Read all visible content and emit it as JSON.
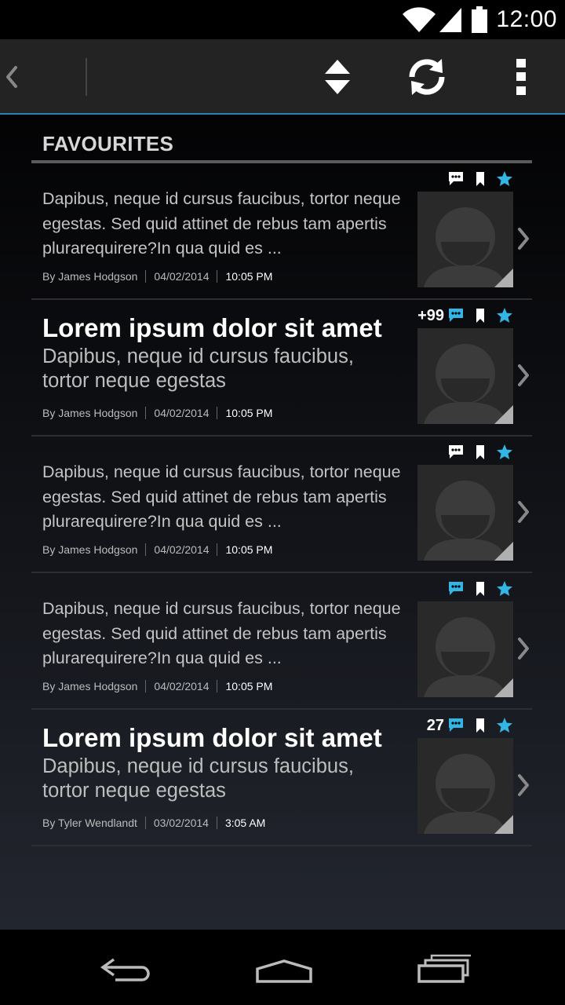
{
  "status_bar": {
    "time": "12:00",
    "icons": [
      "wifi-icon",
      "signal-icon",
      "battery-icon"
    ]
  },
  "action_bar": {
    "icons": [
      "back-icon",
      "sort-icon",
      "refresh-icon",
      "overflow-menu-icon"
    ]
  },
  "section": {
    "title": "FAVOURITES"
  },
  "items": [
    {
      "type": "summary",
      "summary": "Dapibus, neque id cursus faucibus, tortor neque egestas. Sed quid attinet de rebus tam apertis plurarequirere?In qua quid es ...",
      "author": "By James Hodgson",
      "date": "04/02/2014",
      "time": "10:05 PM",
      "comment_count": "",
      "comment_active": false
    },
    {
      "type": "headline",
      "headline": "Lorem ipsum dolor sit amet",
      "subhead": "Dapibus, neque id cursus faucibus, tortor neque egestas",
      "author": "By James Hodgson",
      "date": "04/02/2014",
      "time": "10:05 PM",
      "comment_count": "+99",
      "comment_active": true
    },
    {
      "type": "summary",
      "summary": "Dapibus, neque id cursus faucibus, tortor neque egestas. Sed quid attinet de rebus tam apertis plurarequirere?In qua quid es ...",
      "author": "By James Hodgson",
      "date": "04/02/2014",
      "time": "10:05 PM",
      "comment_count": "",
      "comment_active": false
    },
    {
      "type": "summary",
      "summary": "Dapibus, neque id cursus faucibus, tortor neque egestas. Sed quid attinet de rebus tam apertis plurarequirere?In qua quid es ...",
      "author": "By James Hodgson",
      "date": "04/02/2014",
      "time": "10:05 PM",
      "comment_count": "",
      "comment_active": true
    },
    {
      "type": "headline",
      "headline": "Lorem ipsum dolor sit amet",
      "subhead": "Dapibus, neque id cursus faucibus, tortor neque egestas",
      "author": "By Tyler Wendlandt",
      "date": "03/02/2014",
      "time": "3:05 AM",
      "comment_count": "27",
      "comment_active": true
    }
  ],
  "colors": {
    "accent": "#33b5e5",
    "divider_blue": "#2b80b3",
    "action_bar": "#232323"
  },
  "nav_bar": {
    "icons": [
      "back-nav-icon",
      "home-nav-icon",
      "recent-apps-icon"
    ]
  }
}
